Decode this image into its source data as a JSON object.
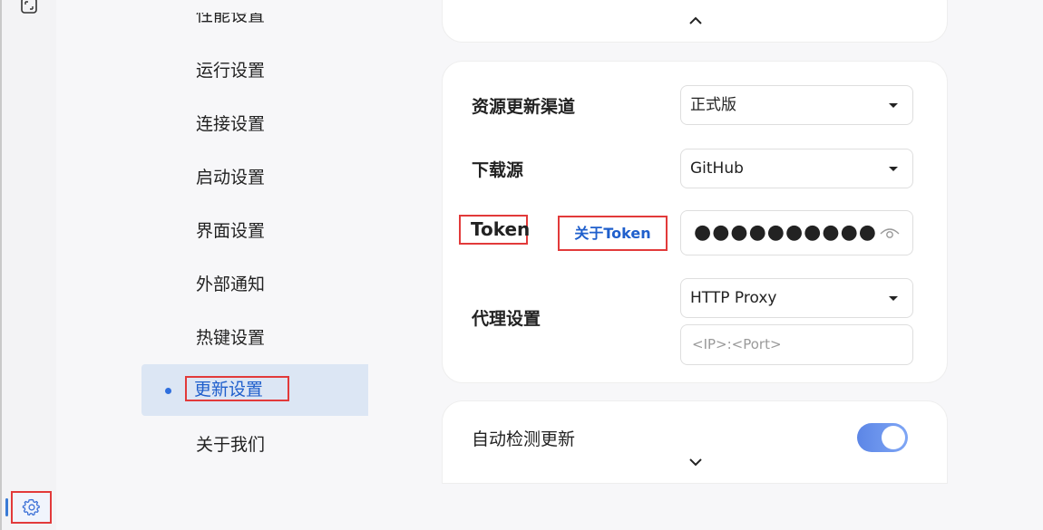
{
  "nav": {
    "items": [
      {
        "label": "性能设置"
      },
      {
        "label": "运行设置"
      },
      {
        "label": "连接设置"
      },
      {
        "label": "启动设置"
      },
      {
        "label": "界面设置"
      },
      {
        "label": "外部通知"
      },
      {
        "label": "热键设置"
      },
      {
        "label": "更新设置"
      },
      {
        "label": "关于我们"
      }
    ],
    "active_index": 7
  },
  "update_settings": {
    "channel_label": "资源更新渠道",
    "channel_value": "正式版",
    "source_label": "下载源",
    "source_value": "GitHub",
    "token_label": "Token",
    "token_link": "关于Token",
    "token_value": "●●●●●●●●●●●●●●",
    "proxy_label": "代理设置",
    "proxy_type": "HTTP Proxy",
    "proxy_placeholder": "<IP>:<Port>",
    "auto_check_label": "自动检测更新",
    "auto_check_enabled": true
  },
  "colors": {
    "accent": "#2f6fde",
    "highlight_box": "#e23a3a",
    "active_bg": "#dce6f4"
  },
  "icons": {
    "rail_top": "fullscreen-icon",
    "rail_bottom": "gear-icon",
    "chevron_up": "chevron-up-icon",
    "chevron_down": "chevron-down-icon",
    "password_toggle": "eye-icon"
  }
}
